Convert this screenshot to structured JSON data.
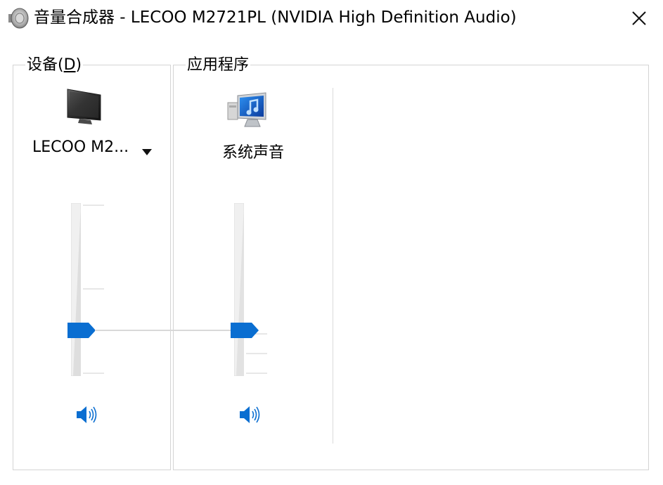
{
  "window": {
    "title": "音量合成器 - LECOO M2721PL (NVIDIA High Definition Audio)",
    "close_icon": "close-icon",
    "app_icon": "speaker-app-icon"
  },
  "device_group": {
    "label": "设备(D)",
    "label_prefix": "设备(",
    "label_mnemonic": "D",
    "label_suffix": ")",
    "device": {
      "icon": "monitor-icon",
      "name": "LECOO M2...",
      "has_dropdown": true,
      "volume_percent": 30,
      "muted": false
    }
  },
  "app_group": {
    "label": "应用程序",
    "apps": [
      {
        "icon": "system-sounds-icon",
        "name": "系统声音",
        "volume_percent": 30,
        "muted": false
      }
    ]
  },
  "colors": {
    "accent": "#0a6ed1",
    "border": "#d4d4d4",
    "track": "#e5e5e5"
  }
}
